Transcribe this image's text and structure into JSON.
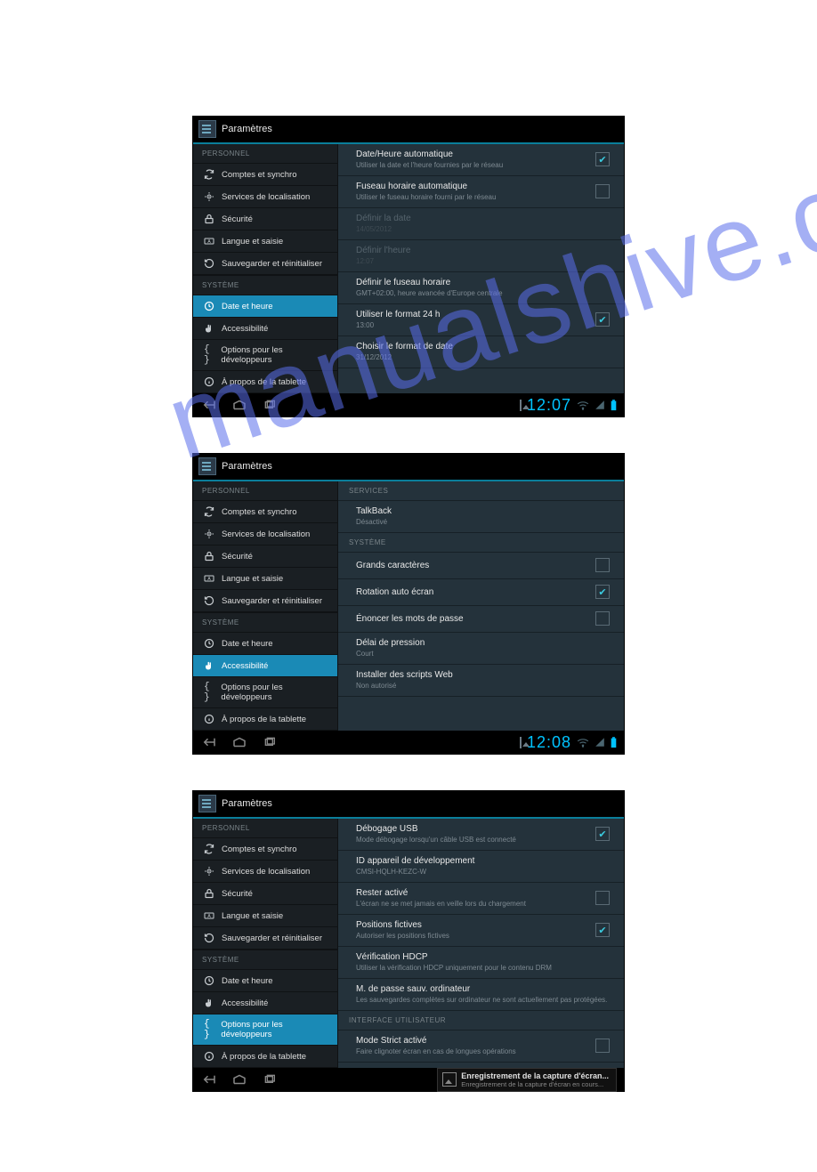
{
  "watermark": "manualshive.com",
  "sidebar": {
    "personnel_header": "PERSONNEL",
    "systeme_header": "SYSTÈME",
    "items": {
      "comptes": {
        "label": "Comptes et synchro",
        "icon": "sync-icon"
      },
      "localisation": {
        "label": "Services de localisation",
        "icon": "location-icon"
      },
      "securite": {
        "label": "Sécurité",
        "icon": "lock-icon"
      },
      "langue": {
        "label": "Langue et saisie",
        "icon": "keyboard-icon"
      },
      "sauvegarde": {
        "label": "Sauvegarder et réinitialiser",
        "icon": "restore-icon"
      },
      "date": {
        "label": "Date et heure",
        "icon": "clock-icon"
      },
      "access": {
        "label": "Accessibilité",
        "icon": "hand-icon"
      },
      "dev": {
        "label": "Options pour les développeurs",
        "icon": "braces-icon"
      },
      "about": {
        "label": "À propos de la tablette",
        "icon": "info-icon"
      }
    }
  },
  "screens": [
    {
      "title": "Paramètres",
      "selected": "date",
      "clock": "12:07",
      "detail": [
        {
          "kind": "row",
          "title": "Date/Heure automatique",
          "sub": "Utiliser la date et l'heure fournies par le réseau",
          "chk": true
        },
        {
          "kind": "row",
          "title": "Fuseau horaire automatique",
          "sub": "Utiliser le fuseau horaire fourni par le réseau",
          "chk": false
        },
        {
          "kind": "row",
          "title": "Définir la date",
          "sub": "14/05/2012",
          "disabled": true
        },
        {
          "kind": "row",
          "title": "Définir l'heure",
          "sub": "12:07",
          "disabled": true
        },
        {
          "kind": "row",
          "title": "Définir le fuseau horaire",
          "sub": "GMT+02:00, heure avancée d'Europe centrale"
        },
        {
          "kind": "row",
          "title": "Utiliser le format 24 h",
          "sub": "13:00",
          "chk": true
        },
        {
          "kind": "row",
          "title": "Choisir le format de date",
          "sub": "31/12/2012"
        }
      ]
    },
    {
      "title": "Paramètres",
      "selected": "access",
      "clock": "12:08",
      "detail": [
        {
          "kind": "header",
          "title": "SERVICES"
        },
        {
          "kind": "row",
          "title": "TalkBack",
          "sub": "Désactivé"
        },
        {
          "kind": "header",
          "title": "SYSTÈME"
        },
        {
          "kind": "row",
          "title": "Grands caractères",
          "chk": false
        },
        {
          "kind": "row",
          "title": "Rotation auto écran",
          "chk": true
        },
        {
          "kind": "row",
          "title": "Énoncer les mots de passe",
          "chk": false
        },
        {
          "kind": "row",
          "title": "Délai de pression",
          "sub": "Court"
        },
        {
          "kind": "row",
          "title": "Installer des scripts Web",
          "sub": "Non autorisé"
        }
      ]
    },
    {
      "title": "Paramètres",
      "selected": "dev",
      "clock": "",
      "toast": {
        "title": "Enregistrement de la capture d'écran...",
        "sub": "Enregistrement de la capture d'écran en cours..."
      },
      "detail": [
        {
          "kind": "row",
          "title": "Débogage USB",
          "sub": "Mode débogage lorsqu'un câble USB est connecté",
          "chk": true
        },
        {
          "kind": "row",
          "title": "ID appareil de développement",
          "sub": "CMSI-HQLH-KEZC-W"
        },
        {
          "kind": "row",
          "title": "Rester activé",
          "sub": "L'écran ne se met jamais en veille lors du chargement",
          "chk": false
        },
        {
          "kind": "row",
          "title": "Positions fictives",
          "sub": "Autoriser les positions fictives",
          "chk": true
        },
        {
          "kind": "row",
          "title": "Vérification HDCP",
          "sub": "Utiliser la vérification HDCP uniquement pour le contenu DRM"
        },
        {
          "kind": "row",
          "title": "M. de passe sauv. ordinateur",
          "sub": "Les sauvegardes complètes sur ordinateur ne sont actuellement pas protégées."
        },
        {
          "kind": "header",
          "title": "INTERFACE UTILISATEUR"
        },
        {
          "kind": "row",
          "title": "Mode Strict activé",
          "sub": "Faire clignoter écran en cas de longues opérations",
          "chk": false
        }
      ]
    }
  ]
}
